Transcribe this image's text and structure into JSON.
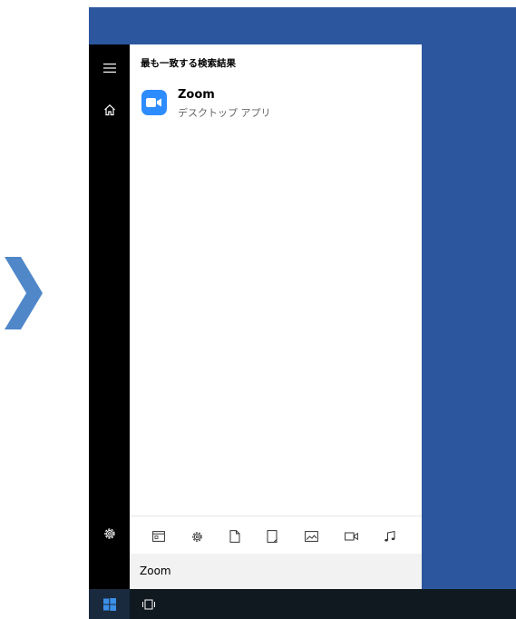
{
  "search_panel": {
    "heading": "最も一致する検索結果",
    "best_match": {
      "name": "Zoom",
      "type": "デスクトップ アプリ"
    },
    "search_query": "Zoom",
    "filters": [
      "apps-icon",
      "settings-icon",
      "documents-icon",
      "folders-icon",
      "photos-icon",
      "videos-icon",
      "music-icon"
    ]
  },
  "sidebar": {
    "items": [
      "hamburger-menu-icon",
      "home-icon",
      "settings-icon"
    ]
  },
  "taskbar": {
    "items": [
      "windows-start-icon",
      "task-view-icon"
    ]
  },
  "colors": {
    "desktop": "#2c579f",
    "sidebar": "#000000",
    "taskbar": "#101820",
    "zoom_brand": "#2d8cff",
    "start_accent": "#3b8fe8",
    "arrow": "#4f87c8"
  }
}
